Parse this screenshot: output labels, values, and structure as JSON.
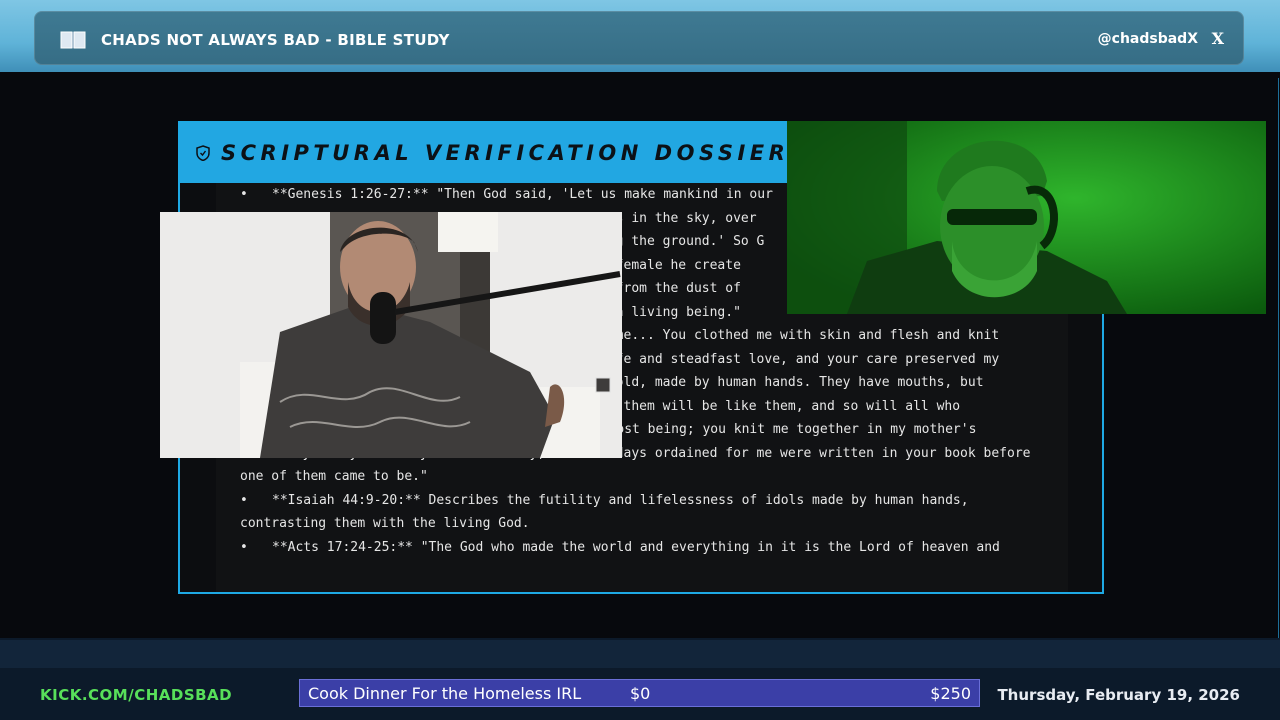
{
  "header": {
    "title": "CHADS NOT ALWAYS BAD - BIBLE STUDY",
    "handle": "@chadsbadX",
    "social_icon": "X",
    "book_icon": "book-icon"
  },
  "dossier": {
    "title": "SCRIPTURAL VERIFICATION DOSSIER",
    "verses": [
      "**Genesis 1:26-27:** \"Then God said, 'Let us make mankind in our",
      "                                            birds in the sky, over",
      "                                            along the ground.' So G",
      "                                            and female he create",
      "                                            man from the dust of",
      "                                            ame a living being.\"",
      "                                            ade me... You clothed me with skin and flesh and knit",
      "                                            e life and steadfast love, and your care preserved my",
      "",
      "                                            nd gold, made by human hands. They have mouths, but",
      "                                            make them will be like them, and so will all who",
      "",
      "**Psalm 139:13-16:** \"For you created my inmost being; you knit me together in my mother's",
      "womb... your eyes saw my unformed body; all the days ordained for me were written in your book before",
      "one of them came to be.\"",
      "**Isaiah 44:9-20:** Describes the futility and lifelessness of idols made by human hands,",
      "contrasting them with the living God.",
      "**Acts 17:24-25:** \"The God who made the world and everything in it is the Lord of heaven and"
    ]
  },
  "footer": {
    "link": "KICK.COM/CHADSBAD",
    "goal_label": "Cook Dinner For the Homeless IRL",
    "goal_current": "$0",
    "goal_target": "$250",
    "goal_progress": 0,
    "date": "Thursday, February 19, 2026"
  }
}
